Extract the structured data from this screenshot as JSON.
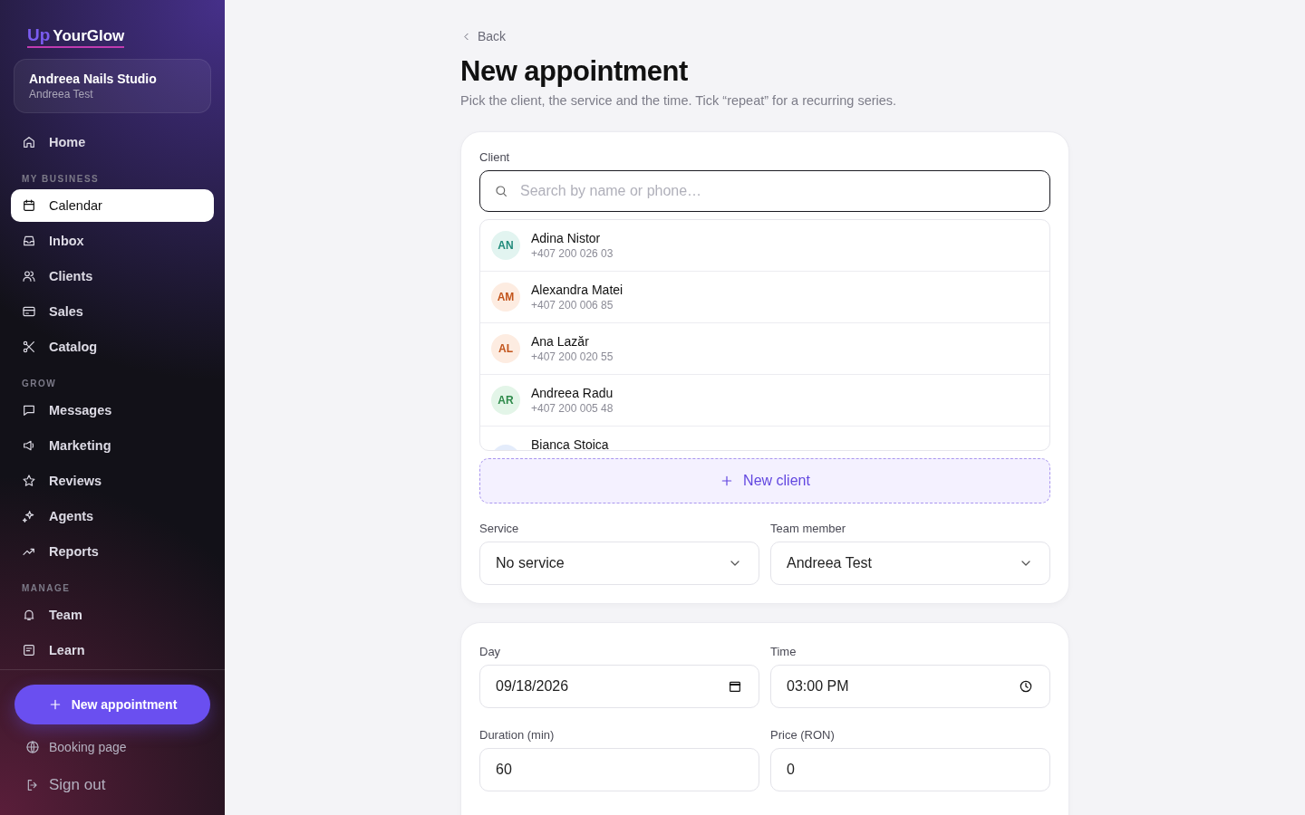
{
  "brand": {
    "prefix": "Up",
    "name": "YourGlow"
  },
  "business": {
    "name": "Andreea Nails Studio",
    "owner": "Andreea Test"
  },
  "nav": [
    {
      "items": [
        {
          "label": "Home",
          "selected": false
        }
      ]
    },
    {
      "heading": "MY BUSINESS",
      "items": [
        {
          "label": "Calendar",
          "selected": true
        },
        {
          "label": "Inbox",
          "selected": false
        },
        {
          "label": "Clients",
          "selected": false
        },
        {
          "label": "Sales",
          "selected": false
        },
        {
          "label": "Catalog",
          "selected": false
        }
      ]
    },
    {
      "heading": "GROW",
      "items": [
        {
          "label": "Messages",
          "selected": false
        },
        {
          "label": "Marketing",
          "selected": false
        },
        {
          "label": "Reviews",
          "selected": false
        },
        {
          "label": "Agents",
          "selected": false
        },
        {
          "label": "Reports",
          "selected": false
        }
      ]
    },
    {
      "heading": "MANAGE",
      "items": [
        {
          "label": "Team",
          "selected": false
        },
        {
          "label": "Learn",
          "selected": false
        }
      ]
    }
  ],
  "primary_button": "New appointment",
  "footer_links": [
    "Booking page",
    "Sign out"
  ],
  "back": "Back",
  "title": "New appointment",
  "subtitle": "Pick the client, the service and the time. Tick “repeat” for a recurring series.",
  "client": {
    "label": "Client",
    "placeholder": "Search by name or phone…",
    "results": [
      {
        "initials": "AN",
        "name": "Adina Nistor",
        "phone": "+407 200 026 03",
        "color": "#1f8a7a"
      },
      {
        "initials": "AM",
        "name": "Alexandra Matei",
        "phone": "+407 200 006 85",
        "color": "#c2541b"
      },
      {
        "initials": "AL",
        "name": "Ana Lazăr",
        "phone": "+407 200 020 55",
        "color": "#c2541b"
      },
      {
        "initials": "AR",
        "name": "Andreea Radu",
        "phone": "+407 200 005 48",
        "color": "#2e8a4a"
      },
      {
        "name": "Bianca Stoica"
      }
    ],
    "new_button": "New client"
  },
  "selects": [
    {
      "label": "Service",
      "value": "No service"
    },
    {
      "label": "Team member",
      "value": "Andreea Test"
    }
  ],
  "fields": [
    {
      "label": "Day",
      "value": "09/18/2026",
      "kind": "date"
    },
    {
      "label": "Time",
      "value": "03:00 PM",
      "kind": "time"
    },
    {
      "label": "Duration (min)",
      "value": "60",
      "kind": "text"
    },
    {
      "label": "Price (RON)",
      "value": "0",
      "kind": "text"
    }
  ]
}
